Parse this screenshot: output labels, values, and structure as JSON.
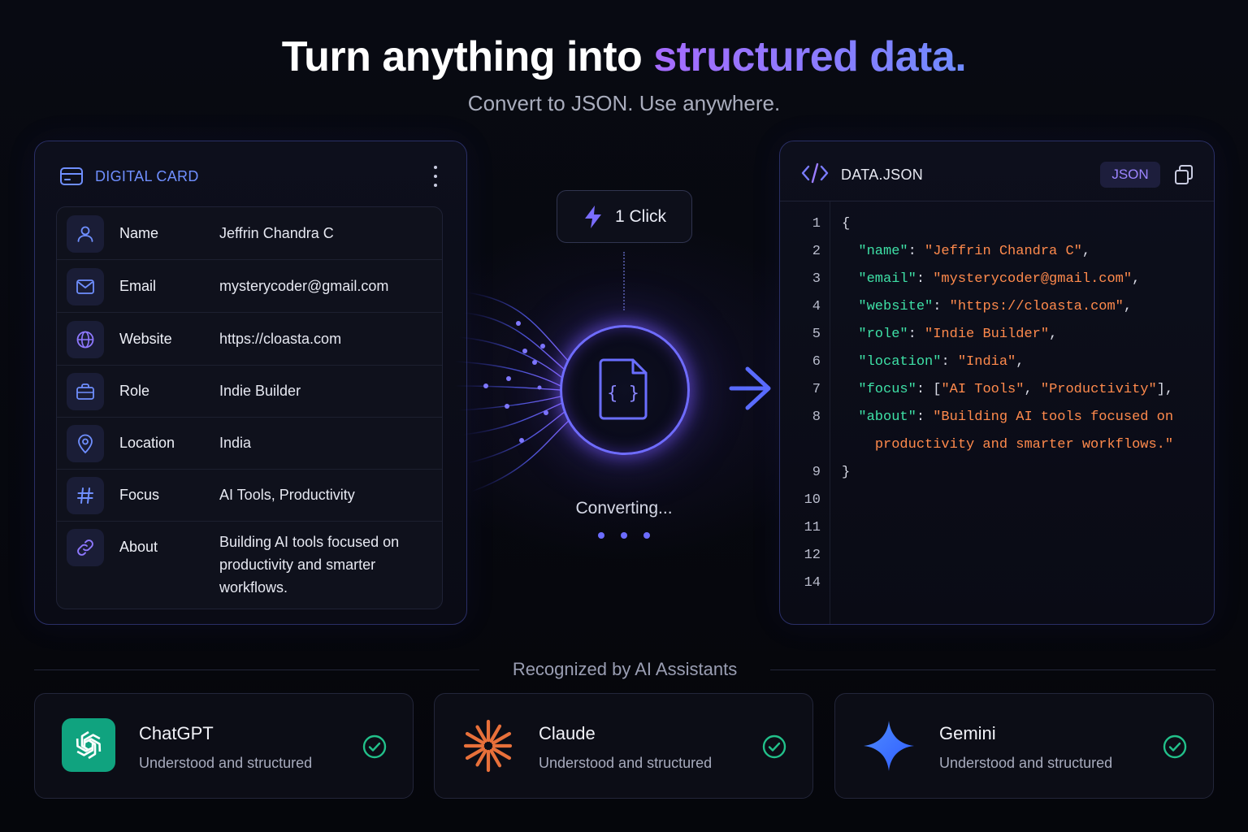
{
  "hero": {
    "title_main": "Turn anything into ",
    "title_accent": "structured data.",
    "subtitle": "Convert to JSON. Use anywhere."
  },
  "card": {
    "title": "DIGITAL CARD",
    "icon": "card-icon",
    "fields": [
      {
        "icon": "user-icon",
        "label": "Name",
        "value": "Jeffrin Chandra C"
      },
      {
        "icon": "mail-icon",
        "label": "Email",
        "value": "mysterycoder@gmail.com"
      },
      {
        "icon": "globe-icon",
        "label": "Website",
        "value": "https://cloasta.com"
      },
      {
        "icon": "briefcase-icon",
        "label": "Role",
        "value": "Indie Builder"
      },
      {
        "icon": "location-pin-icon",
        "label": "Location",
        "value": "India"
      },
      {
        "icon": "hashtag-icon",
        "label": "Focus",
        "value": "AI Tools, Productivity"
      },
      {
        "icon": "link-icon",
        "label": "About",
        "value": "Building AI tools focused on productivity and smarter workflows."
      }
    ]
  },
  "converter": {
    "badge_label": "1 Click",
    "badge_icon": "lightning-icon",
    "status": "Converting...",
    "center_icon": "json-file-icon",
    "accent": "#6f6cff"
  },
  "json_panel": {
    "filename": "DATA.JSON",
    "badge": "JSON",
    "line_numbers": [
      "1",
      "2",
      "3",
      "4",
      "5",
      "6",
      "7",
      "8",
      "",
      "9",
      "10",
      "11",
      "12",
      "14"
    ],
    "lines": [
      {
        "t": [
          {
            "c": "p",
            "v": "{"
          }
        ]
      },
      {
        "t": [
          {
            "c": "p",
            "v": "  "
          },
          {
            "c": "k",
            "v": "\"name\""
          },
          {
            "c": "p",
            "v": ": "
          },
          {
            "c": "s",
            "v": "\"Jeffrin Chandra C\""
          },
          {
            "c": "p",
            "v": ","
          }
        ]
      },
      {
        "t": [
          {
            "c": "p",
            "v": "  "
          },
          {
            "c": "k",
            "v": "\"email\""
          },
          {
            "c": "p",
            "v": ": "
          },
          {
            "c": "s",
            "v": "\"mysterycoder@gmail.com\""
          },
          {
            "c": "p",
            "v": ","
          }
        ]
      },
      {
        "t": [
          {
            "c": "p",
            "v": "  "
          },
          {
            "c": "k",
            "v": "\"website\""
          },
          {
            "c": "p",
            "v": ": "
          },
          {
            "c": "s",
            "v": "\"https://cloasta.com\""
          },
          {
            "c": "p",
            "v": ","
          }
        ]
      },
      {
        "t": [
          {
            "c": "p",
            "v": "  "
          },
          {
            "c": "k",
            "v": "\"role\""
          },
          {
            "c": "p",
            "v": ": "
          },
          {
            "c": "s",
            "v": "\"Indie Builder\""
          },
          {
            "c": "p",
            "v": ","
          }
        ]
      },
      {
        "t": [
          {
            "c": "p",
            "v": "  "
          },
          {
            "c": "k",
            "v": "\"location\""
          },
          {
            "c": "p",
            "v": ": "
          },
          {
            "c": "s",
            "v": "\"India\""
          },
          {
            "c": "p",
            "v": ","
          }
        ]
      },
      {
        "t": [
          {
            "c": "p",
            "v": "  "
          },
          {
            "c": "k",
            "v": "\"focus\""
          },
          {
            "c": "p",
            "v": ": ["
          },
          {
            "c": "s",
            "v": "\"AI Tools\""
          },
          {
            "c": "p",
            "v": ", "
          },
          {
            "c": "s",
            "v": "\"Productivity\""
          },
          {
            "c": "p",
            "v": "],"
          }
        ]
      },
      {
        "t": [
          {
            "c": "p",
            "v": "  "
          },
          {
            "c": "k",
            "v": "\"about\""
          },
          {
            "c": "p",
            "v": ": "
          },
          {
            "c": "s",
            "v": "\"Building AI tools focused on"
          }
        ]
      },
      {
        "t": [
          {
            "c": "p",
            "v": "    "
          },
          {
            "c": "s",
            "v": "productivity and smarter workflows.\""
          }
        ]
      },
      {
        "t": [
          {
            "c": "p",
            "v": "}"
          }
        ]
      }
    ]
  },
  "assistants": {
    "heading": "Recognized by AI Assistants",
    "items": [
      {
        "name": "ChatGPT",
        "status": "Understood and structured",
        "logo": "chatgpt-logo-icon",
        "color": "#10a37f"
      },
      {
        "name": "Claude",
        "status": "Understood and structured",
        "logo": "claude-logo-icon",
        "color": "#e8703a"
      },
      {
        "name": "Gemini",
        "status": "Understood and structured",
        "logo": "gemini-logo-icon",
        "color": "#3f7bff"
      }
    ],
    "check_color": "#22c08a"
  }
}
